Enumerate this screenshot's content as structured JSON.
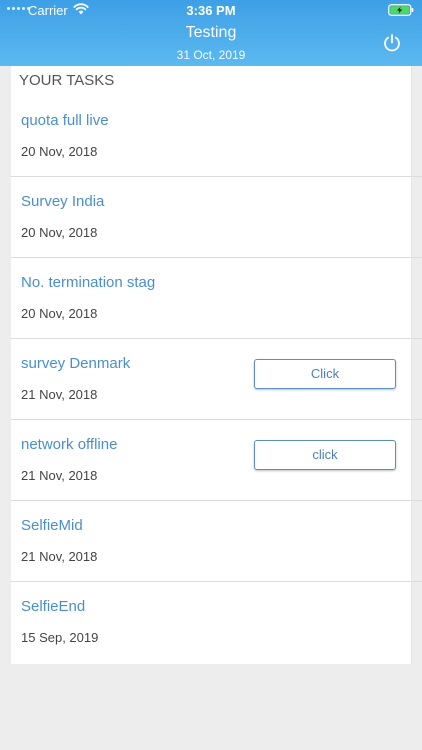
{
  "status_bar": {
    "carrier": "Carrier",
    "time": "3:36 PM"
  },
  "header": {
    "title": "Testing",
    "subtitle": "31 Oct, 2019"
  },
  "tasks_section": {
    "title": "YOUR TASKS"
  },
  "tasks": [
    {
      "name": "quota full live",
      "date": "20 Nov, 2018"
    },
    {
      "name": "Survey India",
      "date": "20 Nov, 2018"
    },
    {
      "name": "No. termination stag",
      "date": "20 Nov, 2018"
    },
    {
      "name": "survey Denmark",
      "date": "21 Nov, 2018",
      "button_label": "Click"
    },
    {
      "name": "network offline",
      "date": "21 Nov, 2018",
      "button_label": "click"
    },
    {
      "name": "SelfieMid",
      "date": "21 Nov, 2018"
    },
    {
      "name": "SelfieEnd",
      "date": "15 Sep, 2019"
    }
  ],
  "colors": {
    "header_gradient_top": "#3d9fe6",
    "header_gradient_bottom": "#5cb9f0",
    "task_name": "#4a8fcc",
    "page_background": "#ededed"
  },
  "icons": {
    "status_wifi": "wifi-icon",
    "status_battery": "battery-charging-icon",
    "header_action": "power-icon"
  }
}
